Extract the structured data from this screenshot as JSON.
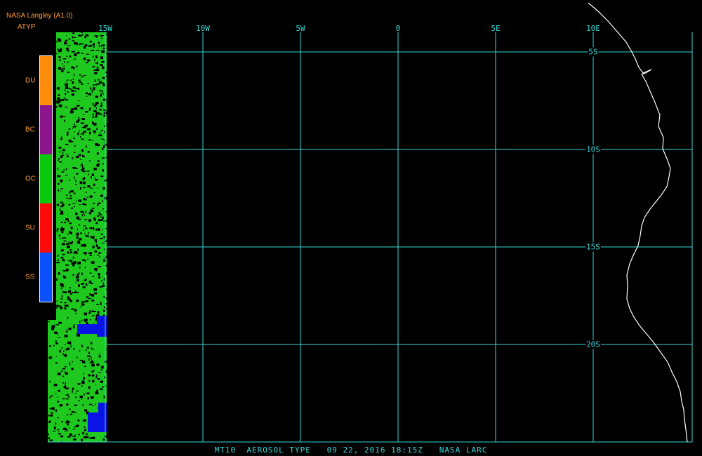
{
  "header": {
    "title": "NASA Langley (A1.0)",
    "product": "ATYP",
    "text_color": "#ff9b32"
  },
  "map": {
    "grid_color": "#37d7d7",
    "coast_color": "#ffffff",
    "longitude_labels": [
      "15W",
      "10W",
      "5W",
      "0",
      "5E",
      "10E"
    ],
    "longitude_values": [
      -15,
      -10,
      -5,
      0,
      5,
      10
    ],
    "latitude_labels": [
      "5S",
      "10S",
      "15S",
      "20S"
    ],
    "latitude_values": [
      -5,
      -10,
      -15,
      -20
    ]
  },
  "legend": {
    "items": [
      {
        "label": "DU",
        "color": "#ff8c0a"
      },
      {
        "label": "BC",
        "color": "#8c148c"
      },
      {
        "label": "OC",
        "color": "#0ac80a"
      },
      {
        "label": "SU",
        "color": "#ff0a0a"
      },
      {
        "label": "SS",
        "color": "#0a50ff"
      }
    ]
  },
  "footer": {
    "text": "MT10  AEROSOL TYPE   09 22, 2016 18:15Z   NASA LARC"
  },
  "data_colors": {
    "oc_swath": "#1ec81e",
    "ss_swath": "#0a14e6"
  }
}
